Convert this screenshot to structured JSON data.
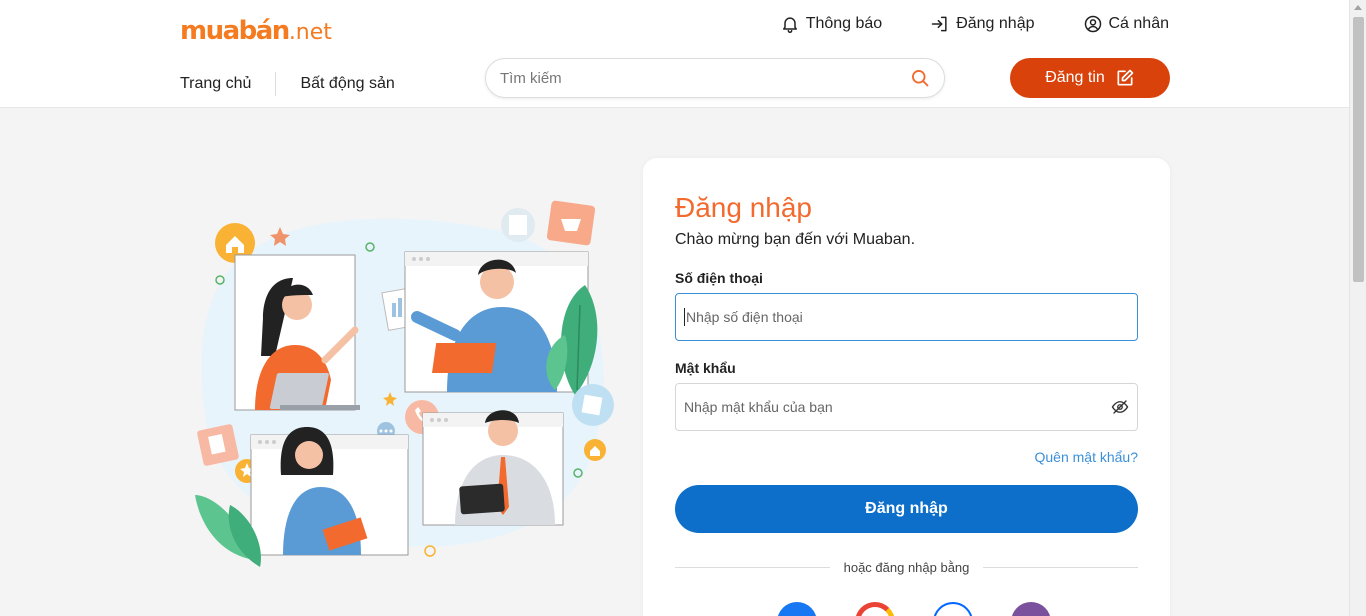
{
  "logo": {
    "brand": "muabán",
    "suffix": ".net"
  },
  "top_links": [
    {
      "label": "Thông báo",
      "icon": "bell-icon"
    },
    {
      "label": "Đăng nhập",
      "icon": "login-icon"
    },
    {
      "label": "Cá nhân",
      "icon": "user-icon"
    }
  ],
  "nav": {
    "home": "Trang chủ",
    "real_estate": "Bất động sản"
  },
  "search": {
    "placeholder": "Tìm kiếm",
    "icon": "search-icon"
  },
  "post_button": {
    "label": "Đăng tin",
    "icon": "edit-icon"
  },
  "login": {
    "title": "Đăng nhập",
    "subtitle": "Chào mừng bạn đến với Muaban.",
    "phone_label": "Số điện thoại",
    "phone_placeholder": "Nhập số điện thoại",
    "password_label": "Mật khẩu",
    "password_placeholder": "Nhập mật khẩu của bạn",
    "forgot": "Quên mật khẩu?",
    "submit": "Đăng nhập",
    "or_text": "hoặc đăng nhập bằng",
    "social_providers": [
      "facebook-icon",
      "google-icon",
      "zalo-icon",
      "viber-icon"
    ]
  },
  "colors": {
    "brand_orange": "#f47b20",
    "cta_red": "#d9420b",
    "primary_blue": "#0d6fc9",
    "link_blue": "#3b8fd9",
    "title_orange": "#f26a2e"
  }
}
